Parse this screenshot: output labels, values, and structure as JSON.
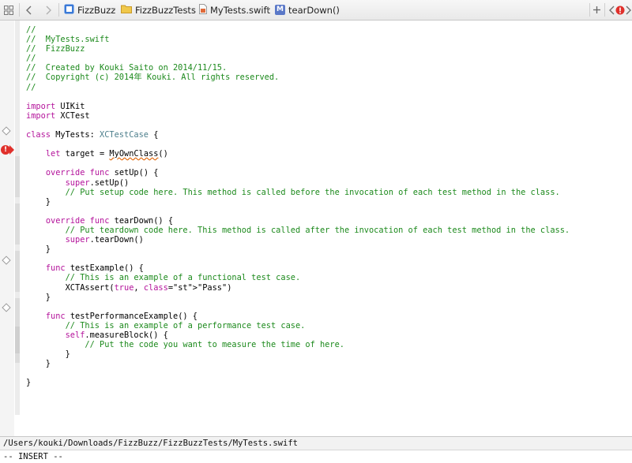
{
  "jumpbar": {
    "crumbs": [
      {
        "label": "FizzBuzz",
        "icon": "project-icon"
      },
      {
        "label": "FizzBuzzTests",
        "icon": "folder-icon"
      },
      {
        "label": "MyTests.swift",
        "icon": "swift-file-icon"
      },
      {
        "label": "tearDown()",
        "icon": "method-icon",
        "badge": "M"
      }
    ]
  },
  "editor": {
    "lines": [
      "//",
      "//  MyTests.swift",
      "//  FizzBuzz",
      "//",
      "//  Created by Kouki Saito on 2014/11/15.",
      "//  Copyright (c) 2014年 Kouki. All rights reserved.",
      "//",
      "",
      "import UIKit",
      "import XCTest",
      "",
      "class MyTests: XCTestCase {",
      "",
      "    let target = MyOwnClass()",
      "",
      "    override func setUp() {",
      "        super.setUp()",
      "        // Put setup code here. This method is called before the invocation of each test method in the class.",
      "    }",
      "",
      "    override func tearDown() {",
      "        // Put teardown code here. This method is called after the invocation of each test method in the class.",
      "        super.tearDown()",
      "    }",
      "",
      "    func testExample() {",
      "        // This is an example of a functional test case.",
      "        XCTAssert(true, \"Pass\")",
      "    }",
      "",
      "    func testPerformanceExample() {",
      "        // This is an example of a performance test case.",
      "        self.measureBlock() {",
      "            // Put the code you want to measure the time of here.",
      "        }",
      "    }",
      "",
      "}"
    ]
  },
  "status": {
    "path": "/Users/kouki/Downloads/FizzBuzz/FizzBuzzTests/MyTests.swift",
    "mode": "-- INSERT --"
  },
  "error_badge": "!",
  "colors": {
    "comment": "#1d8a1d",
    "keyword": "#b4139b",
    "type": "#4d7f8c",
    "string": "#c41a16",
    "error": "#e0302b"
  }
}
